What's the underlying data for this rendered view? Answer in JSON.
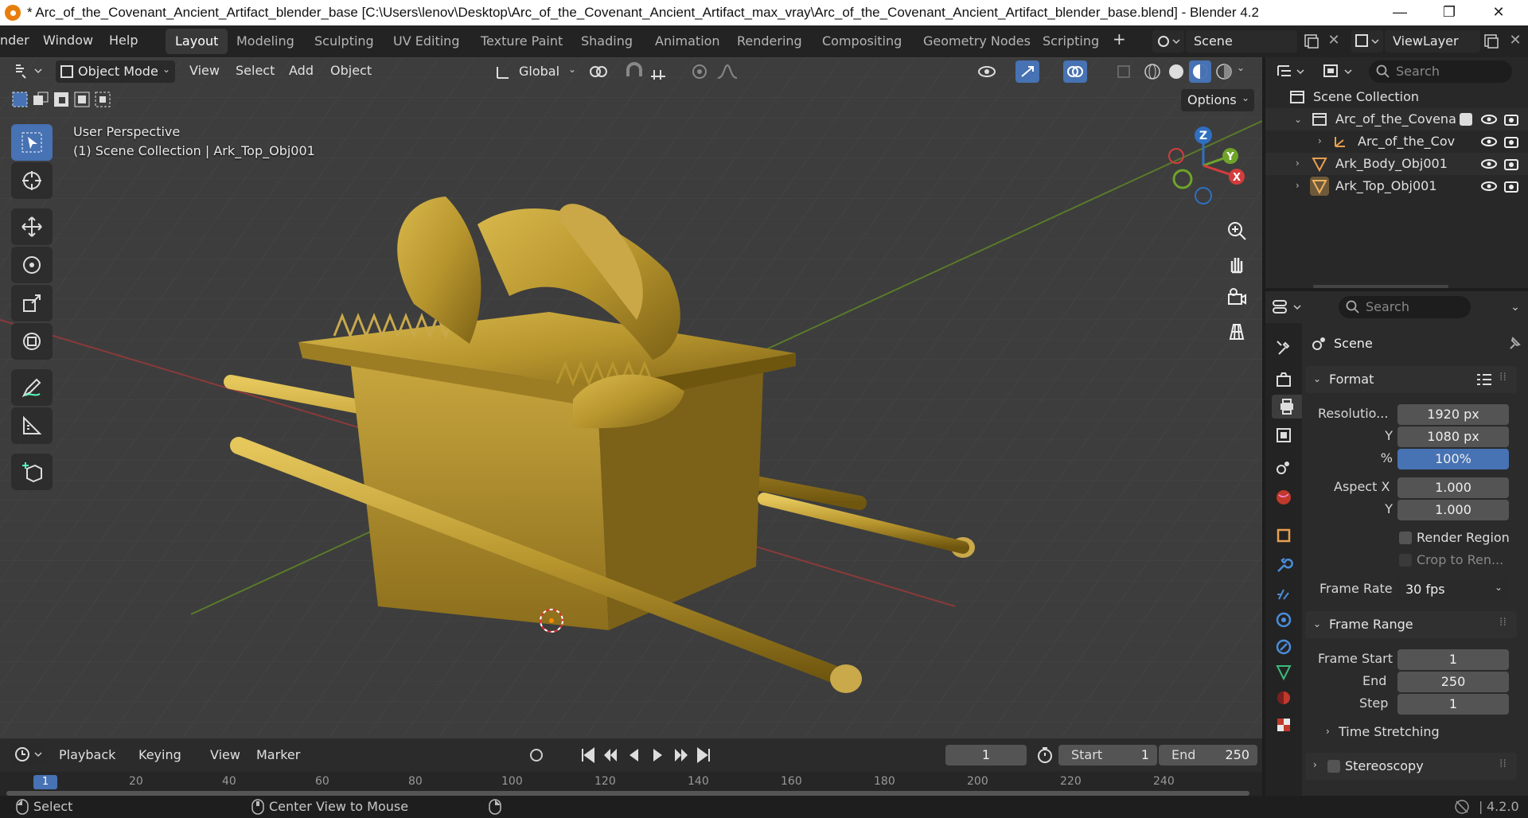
{
  "window": {
    "title": "* Arc_of_the_Covenant_Ancient_Artifact_blender_base [C:\\Users\\lenov\\Desktop\\Arc_of_the_Covenant_Ancient_Artifact_max_vray\\Arc_of_the_Covenant_Ancient_Artifact_blender_base.blend] - Blender 4.2",
    "minimize": "—",
    "maximize": "❐",
    "close": "✕"
  },
  "menu": {
    "render": "nder",
    "window": "Window",
    "help": "Help"
  },
  "workspaces": [
    "Layout",
    "Modeling",
    "Sculpting",
    "UV Editing",
    "Texture Paint",
    "Shading",
    "Animation",
    "Rendering",
    "Compositing",
    "Geometry Nodes",
    "Scripting"
  ],
  "workspace_add": "+",
  "scene_field": "Scene",
  "viewlayer_field": "ViewLayer",
  "viewport_header": {
    "mode": "Object Mode",
    "view": "View",
    "select": "Select",
    "add": "Add",
    "object": "Object",
    "orientation": "Global",
    "options": "Options"
  },
  "viewport_overlay": {
    "perspective": "User Perspective",
    "collection": "(1) Scene Collection | Ark_Top_Obj001"
  },
  "gizmo": {
    "x": "X",
    "y": "Y",
    "z": "Z"
  },
  "outliner": {
    "search_placeholder": "Search",
    "rows": [
      {
        "label": "Scene Collection"
      },
      {
        "label": "Arc_of_the_Covena"
      },
      {
        "label": "Arc_of_the_Cov"
      },
      {
        "label": "Ark_Body_Obj001"
      },
      {
        "label": "Ark_Top_Obj001"
      }
    ]
  },
  "properties": {
    "search_placeholder": "Search",
    "context": "Scene",
    "format_panel": "Format",
    "resolution_x_label": "Resolutio...",
    "resolution_x": "1920 px",
    "resolution_y_label": "Y",
    "resolution_y": "1080 px",
    "percent_label": "%",
    "percent": "100%",
    "aspect_x_label": "Aspect X",
    "aspect_x": "1.000",
    "aspect_y_label": "Y",
    "aspect_y": "1.000",
    "render_region": "Render Region",
    "crop": "Crop to Ren...",
    "frame_rate_label": "Frame Rate",
    "frame_rate": "30 fps",
    "frame_range_panel": "Frame Range",
    "frame_start_label": "Frame Start",
    "frame_start": "1",
    "end_label": "End",
    "end": "250",
    "step_label": "Step",
    "step": "1",
    "time_stretching": "Time Stretching",
    "stereoscopy": "Stereoscopy"
  },
  "timeline": {
    "playback": "Playback",
    "keying": "Keying",
    "view": "View",
    "marker": "Marker",
    "current_frame": "1",
    "start_label": "Start",
    "start": "1",
    "end_label": "End",
    "end": "250",
    "ticks": [
      "1",
      "20",
      "40",
      "60",
      "80",
      "100",
      "120",
      "140",
      "160",
      "180",
      "200",
      "220",
      "240"
    ]
  },
  "status": {
    "select": "Select",
    "center": "Center View to Mouse",
    "version": "4.2.0"
  },
  "colors": {
    "accent": "#4772b3",
    "gold": "#b8962e",
    "x_axis": "#c0392b",
    "y_axis": "#5f8a2c"
  }
}
